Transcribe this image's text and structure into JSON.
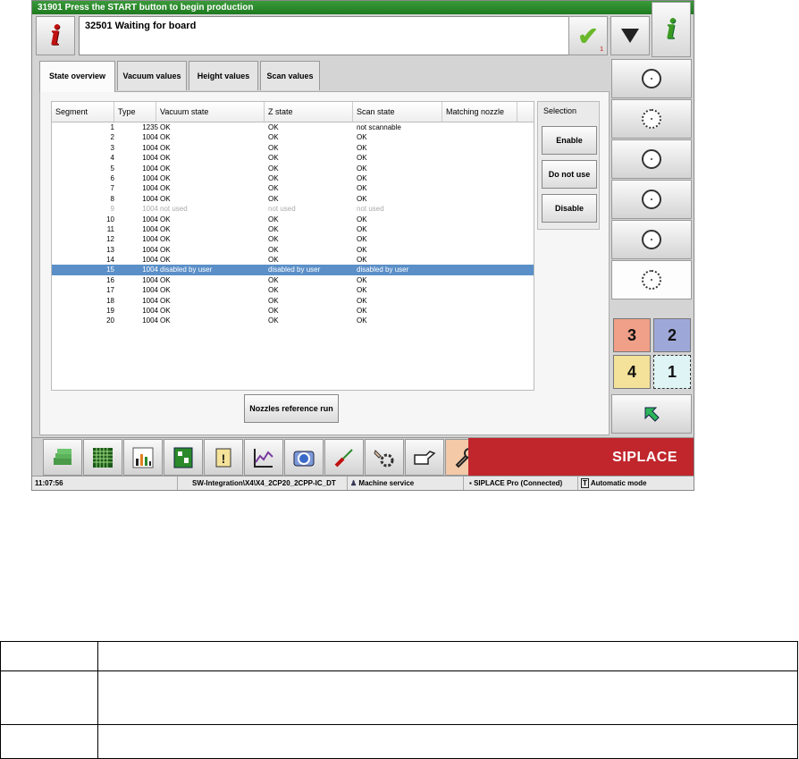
{
  "window": {
    "title": "31901 Press the START button to begin production",
    "message": "32501 Waiting for board",
    "check_badge": "1",
    "colors": {
      "title_bar": "#2e8b2e",
      "selection": "#5b8fc8",
      "brand": "#c0262c"
    }
  },
  "tabs": [
    {
      "label": "State overview",
      "active": true
    },
    {
      "label": "Vacuum values",
      "active": false
    },
    {
      "label": "Height values",
      "active": false
    },
    {
      "label": "Scan values",
      "active": false
    }
  ],
  "table": {
    "headers": [
      "Segment",
      "Type",
      "Vacuum state",
      "Z state",
      "Scan state",
      "Matching nozzle"
    ],
    "rows": [
      {
        "seg": "1",
        "type": "1235",
        "vac": "OK",
        "z": "OK",
        "scan": "not scannable"
      },
      {
        "seg": "2",
        "type": "1004",
        "vac": "OK",
        "z": "OK",
        "scan": "OK"
      },
      {
        "seg": "3",
        "type": "1004",
        "vac": "OK",
        "z": "OK",
        "scan": "OK"
      },
      {
        "seg": "4",
        "type": "1004",
        "vac": "OK",
        "z": "OK",
        "scan": "OK"
      },
      {
        "seg": "5",
        "type": "1004",
        "vac": "OK",
        "z": "OK",
        "scan": "OK"
      },
      {
        "seg": "6",
        "type": "1004",
        "vac": "OK",
        "z": "OK",
        "scan": "OK"
      },
      {
        "seg": "7",
        "type": "1004",
        "vac": "OK",
        "z": "OK",
        "scan": "OK"
      },
      {
        "seg": "8",
        "type": "1004",
        "vac": "OK",
        "z": "OK",
        "scan": "OK"
      },
      {
        "seg": "9",
        "type": "1004",
        "vac": "not used",
        "z": "not used",
        "scan": "not used",
        "state": "unused"
      },
      {
        "seg": "10",
        "type": "1004",
        "vac": "OK",
        "z": "OK",
        "scan": "OK"
      },
      {
        "seg": "11",
        "type": "1004",
        "vac": "OK",
        "z": "OK",
        "scan": "OK"
      },
      {
        "seg": "12",
        "type": "1004",
        "vac": "OK",
        "z": "OK",
        "scan": "OK"
      },
      {
        "seg": "13",
        "type": "1004",
        "vac": "OK",
        "z": "OK",
        "scan": "OK"
      },
      {
        "seg": "14",
        "type": "1004",
        "vac": "OK",
        "z": "OK",
        "scan": "OK"
      },
      {
        "seg": "15",
        "type": "1004",
        "vac": "disabled by user",
        "z": "disabled by user",
        "scan": "disabled by user",
        "state": "selected"
      },
      {
        "seg": "16",
        "type": "1004",
        "vac": "OK",
        "z": "OK",
        "scan": "OK"
      },
      {
        "seg": "17",
        "type": "1004",
        "vac": "OK",
        "z": "OK",
        "scan": "OK"
      },
      {
        "seg": "18",
        "type": "1004",
        "vac": "OK",
        "z": "OK",
        "scan": "OK"
      },
      {
        "seg": "19",
        "type": "1004",
        "vac": "OK",
        "z": "OK",
        "scan": "OK"
      },
      {
        "seg": "20",
        "type": "1004",
        "vac": "OK",
        "z": "OK",
        "scan": "OK"
      }
    ]
  },
  "selection": {
    "title": "Selection",
    "enable": "Enable",
    "do_not_use": "Do not use",
    "disable": "Disable"
  },
  "reference_button": "Nozzles reference run",
  "head_buttons": {
    "h3": "3",
    "h2": "2",
    "h4": "4",
    "h1": "1"
  },
  "brand": "SIPLACE",
  "status": {
    "time": "11:07:56",
    "path": "SW-Integration\\X4\\X4_2CP20_2CPP-IC_DT",
    "service": "Machine service",
    "connection": "SIPLACE Pro (Connected)",
    "mode": "Automatic mode"
  }
}
